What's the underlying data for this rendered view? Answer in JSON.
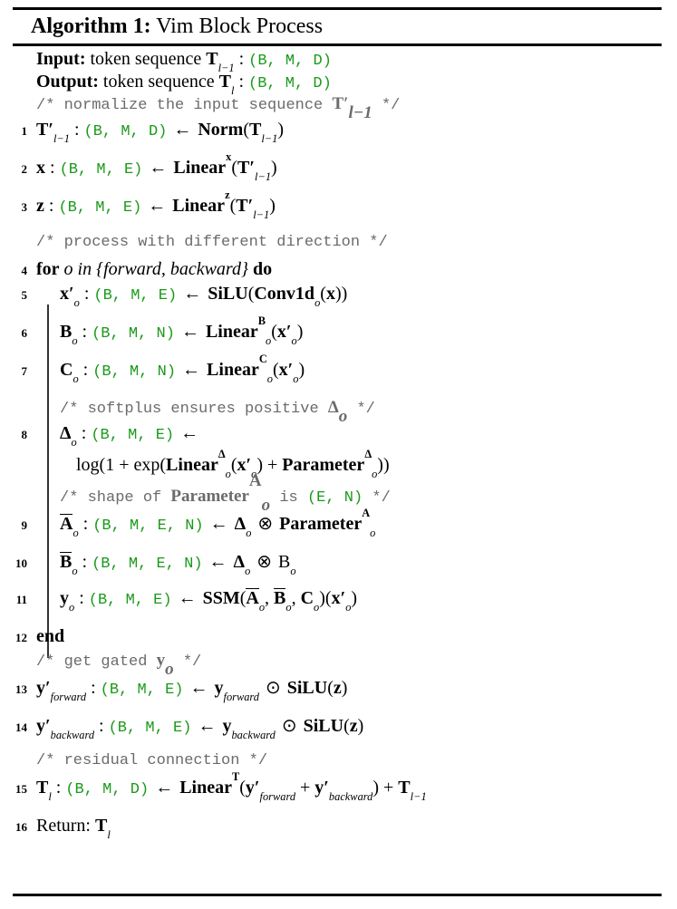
{
  "title": {
    "label": "Algorithm 1:",
    "name": "Vim Block Process"
  },
  "colors": {
    "shape_green": "#1a9a1a",
    "comment_gray": "#6b6b6b",
    "text_black": "#000000",
    "rule_black": "#000000"
  },
  "io": {
    "input_label": "Input:",
    "input_text": "token sequence",
    "input_var": "T",
    "input_var_sub": "l−1",
    "input_shape": "(B, M, D)",
    "output_label": "Output:",
    "output_text": "token sequence",
    "output_var": "T",
    "output_var_sub": "l",
    "output_shape": "(B, M, D)"
  },
  "comments": {
    "c1_pre": "/* normalize the input sequence ",
    "c1_math": "T′",
    "c1_math_sub": "l−1",
    "c1_post": " */",
    "c2": "/* process with different direction */",
    "c3_pre": "/* softplus ensures positive ",
    "c3_math": "Δ",
    "c3_math_sub": "o",
    "c3_post": " */",
    "c4_pre": "/* shape of ",
    "c4_math": "Parameter",
    "c4_math_sup": "A",
    "c4_math_sub": "o",
    "c4_mid": " is ",
    "c4_shape": "(E, N)",
    "c4_post": " */",
    "c5_pre": "/* get gated ",
    "c5_math": "y",
    "c5_math_sub": "o",
    "c5_post": " */",
    "c6": "/* residual connection */"
  },
  "lines": {
    "n1": "1",
    "n2": "2",
    "n3": "3",
    "n4": "4",
    "n5": "5",
    "n6": "6",
    "n7": "7",
    "n8": "8",
    "n9": "9",
    "n10": "10",
    "n11": "11",
    "n12": "12",
    "n13": "13",
    "n14": "14",
    "n15": "15",
    "n16": "16"
  },
  "statements": {
    "s1": {
      "lhs": "T′",
      "lhs_sub": "l−1",
      "shape": "(B, M, D)",
      "arrow": "←",
      "rhs_fn": "Norm",
      "rhs_arg": "T",
      "rhs_arg_sub": "l−1"
    },
    "s2": {
      "lhs": "x",
      "shape": "(B, M, E)",
      "arrow": "←",
      "rhs_fn": "Linear",
      "rhs_sup": "x",
      "rhs_arg": "T′",
      "rhs_arg_sub": "l−1"
    },
    "s3": {
      "lhs": "z",
      "shape": "(B, M, E)",
      "arrow": "←",
      "rhs_fn": "Linear",
      "rhs_sup": "z",
      "rhs_arg": "T′",
      "rhs_arg_sub": "l−1"
    },
    "s4": {
      "kw_for": "for",
      "var": "o",
      "kw_in": "in",
      "set": "{forward, backward}",
      "kw_do": "do"
    },
    "s5": {
      "lhs": "x′",
      "lhs_sub": "o",
      "shape": "(B, M, E)",
      "arrow": "←",
      "outer_fn": "SiLU",
      "inner_fn": "Conv1d",
      "inner_sub": "o",
      "inner_arg": "x"
    },
    "s6": {
      "lhs": "B",
      "lhs_sub": "o",
      "shape": "(B, M, N)",
      "arrow": "←",
      "rhs_fn": "Linear",
      "rhs_sup": "B",
      "rhs_sub": "o",
      "rhs_arg": "x′",
      "rhs_arg_sub": "o"
    },
    "s7": {
      "lhs": "C",
      "lhs_sub": "o",
      "shape": "(B, M, N)",
      "arrow": "←",
      "rhs_fn": "Linear",
      "rhs_sup": "C",
      "rhs_sub": "o",
      "rhs_arg": "x′",
      "rhs_arg_sub": "o"
    },
    "s8": {
      "lhs": "Δ",
      "lhs_sub": "o",
      "shape": "(B, M, E)",
      "arrow": "←",
      "cont_log": "log(1 + exp(",
      "cont_fn1": "Linear",
      "cont_fn1_sup": "Δ",
      "cont_fn1_sub": "o",
      "cont_fn1_arg": "x′",
      "cont_fn1_arg_sub": "o",
      "cont_plus": " + ",
      "cont_fn2": "Parameter",
      "cont_fn2_sup": "Δ",
      "cont_fn2_sub": "o",
      "cont_close": "))"
    },
    "s9": {
      "lhs": "A",
      "lhs_sub": "o",
      "shape": "(B, M, E, N)",
      "arrow": "←",
      "rhs_delta": "Δ",
      "rhs_delta_sub": "o",
      "op": "⊗",
      "rhs_param": "Parameter",
      "rhs_param_sup": "A",
      "rhs_param_sub": "o"
    },
    "s10": {
      "lhs": "B",
      "lhs_sub": "o",
      "shape": "(B, M, E, N)",
      "arrow": "←",
      "rhs_delta": "Δ",
      "rhs_delta_sub": "o",
      "op": "⊗",
      "rhs_b": "B",
      "rhs_b_sub": "o"
    },
    "s11": {
      "lhs": "y",
      "lhs_sub": "o",
      "shape": "(B, M, E)",
      "arrow": "←",
      "fn": "SSM",
      "a1": "A",
      "a1_sub": "o",
      "a2": "B",
      "a2_sub": "o",
      "a3": "C",
      "a3_sub": "o",
      "arg": "x′",
      "arg_sub": "o"
    },
    "s12": {
      "kw_end": "end"
    },
    "s13": {
      "lhs": "y′",
      "lhs_sub": "forward",
      "shape": "(B, M, E)",
      "arrow": "←",
      "rhs_y": "y",
      "rhs_y_sub": "forward",
      "op": "⊙",
      "rhs_fn": "SiLU",
      "rhs_arg": "z"
    },
    "s14": {
      "lhs": "y′",
      "lhs_sub": "backward",
      "shape": "(B, M, E)",
      "arrow": "←",
      "rhs_y": "y",
      "rhs_y_sub": "backward",
      "op": "⊙",
      "rhs_fn": "SiLU",
      "rhs_arg": "z"
    },
    "s15": {
      "lhs": "T",
      "lhs_sub": "l",
      "shape": "(B, M, D)",
      "arrow": "←",
      "rhs_fn": "Linear",
      "rhs_sup": "T",
      "arg1": "y′",
      "arg1_sub": "forward",
      "plus": " + ",
      "arg2": "y′",
      "arg2_sub": "backward",
      "tail_plus": " + ",
      "tail_var": "T",
      "tail_var_sub": "l−1"
    },
    "s16": {
      "kw_return": "Return:",
      "var": "T",
      "var_sub": "l"
    }
  }
}
